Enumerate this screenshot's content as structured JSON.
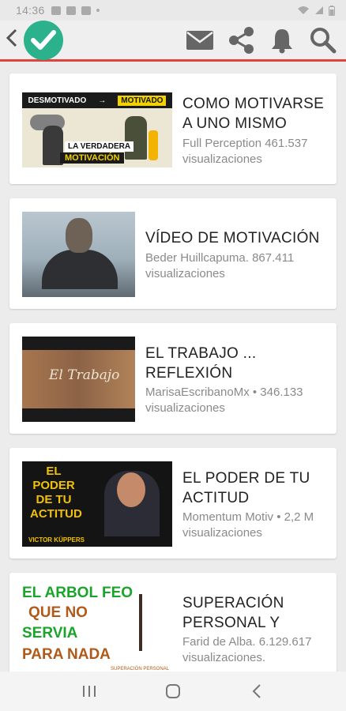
{
  "status_bar": {
    "time": "14:36",
    "right_text": "📶 ▮"
  },
  "app_bar": {
    "back_icon": "chevron-left-icon",
    "logo_icon": "check-circle-icon",
    "actions": [
      {
        "name": "mail",
        "icon": "mail-icon"
      },
      {
        "name": "share",
        "icon": "share-icon"
      },
      {
        "name": "notifications",
        "icon": "bell-icon"
      },
      {
        "name": "search",
        "icon": "search-icon"
      }
    ],
    "accent_color": "#e0443e",
    "logo_color": "#2bb28d"
  },
  "videos": [
    {
      "title": "COMO MOTIVARSE A UNO MISMO",
      "meta": "Full Perception 461.537 visualizaciones",
      "thumbnail": {
        "left_label": "DESMOTIVADO",
        "arrow": "→",
        "right_label": "MOTIVADO",
        "line1": "LA VERDADERA",
        "line2": "MOTIVACIÓN"
      }
    },
    {
      "title": "VÍDEO DE MOTIVACIÓN",
      "meta": "Beder Huillcapuma. 867.411 visualizaciones",
      "thumbnail": {}
    },
    {
      "title": "EL TRABAJO ... REFLEXIÓN",
      "meta": "MarisaEscribanoMx • 346.133 visualizaciones",
      "thumbnail": {
        "text": "El Trabajo"
      }
    },
    {
      "title": "EL PODER DE TU ACTITUD",
      "meta": "Momentum Motiv • 2,2 M visualizaciones",
      "thumbnail": {
        "line1": "EL",
        "line2": "PODER",
        "line3": "DE TU",
        "line4": "ACTITUD",
        "name": "VICTOR KÜPPERS"
      }
    },
    {
      "title": "SUPERACIÓN PERSONAL Y",
      "meta": "Farid de Alba. 6.129.617 visualizaciones.",
      "thumbnail": {
        "line1": "EL ARBOL FEO",
        "line2": "QUE NO",
        "line3": "SERVIA",
        "line4": "PARA NADA",
        "caption": "SUPERACIÓN PERSONAL"
      }
    }
  ],
  "nav_bar": [
    {
      "name": "recents",
      "icon": "recents-icon"
    },
    {
      "name": "home",
      "icon": "home-icon"
    },
    {
      "name": "back",
      "icon": "back-icon"
    }
  ]
}
